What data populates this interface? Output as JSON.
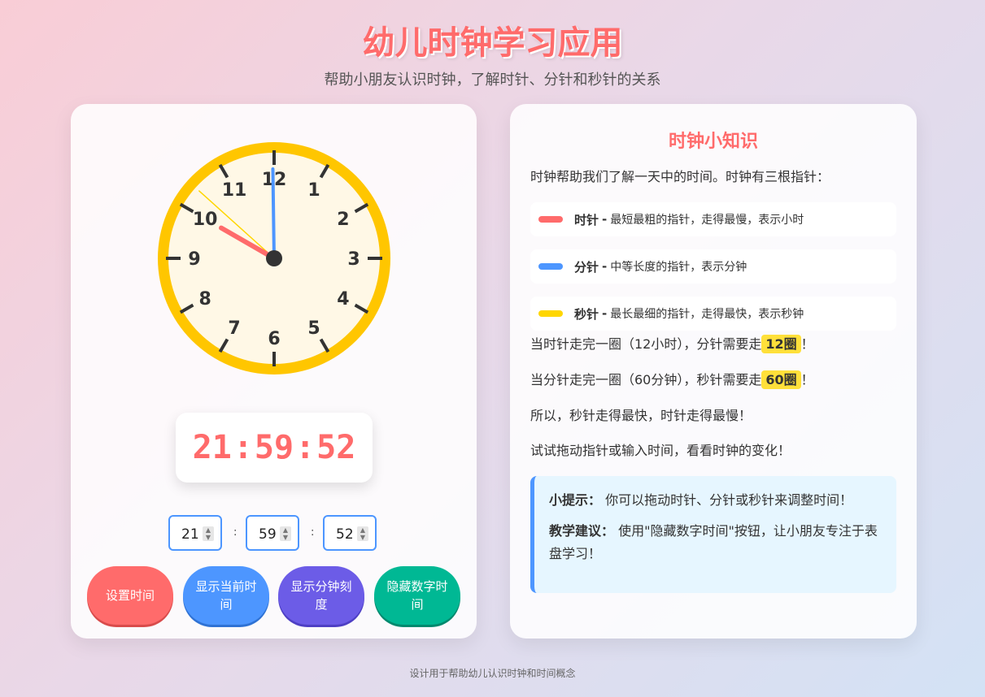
{
  "page": {
    "title": "幼儿时钟学习应用",
    "subtitle": "帮助小朋友认识时钟，了解时针、分针和秒针的关系",
    "footer": "设计用于帮助幼儿认识时钟和时间概念"
  },
  "clock": {
    "numbers": [
      "12",
      "1",
      "2",
      "3",
      "4",
      "5",
      "6",
      "7",
      "8",
      "9",
      "10",
      "11"
    ],
    "time": {
      "hours": 21,
      "minutes": 59,
      "seconds": 52
    },
    "digital": {
      "h": "21",
      "m": "59",
      "s": "52",
      "sep": ":"
    },
    "colors": {
      "rim": "#ffc600",
      "face": "#fff8e6",
      "hour_hand": "#ff6b6b",
      "minute_hand": "#4d96ff",
      "second_hand": "#ffd600"
    }
  },
  "inputs": {
    "hour": "21",
    "minute": "59",
    "second": "52",
    "sep": ":"
  },
  "buttons": {
    "set_time": "设置时间",
    "show_current": "显示当前时间",
    "show_minute_ticks": "显示分钟刻度",
    "hide_digital": "隐藏数字时间"
  },
  "info": {
    "title": "时钟小知识",
    "intro": "时钟帮助我们了解一天中的时间。时钟有三根指针：",
    "hands": [
      {
        "name": "时针",
        "sep": " - ",
        "desc": "最短最粗的指针，走得最慢，表示小时",
        "color": "#ff6b6b"
      },
      {
        "name": "分针",
        "sep": " - ",
        "desc": "中等长度的指针，表示分钟",
        "color": "#4d96ff"
      },
      {
        "name": "秒针",
        "sep": " - ",
        "desc": "最长最细的指针，走得最快，表示秒钟",
        "color": "#ffd600"
      }
    ],
    "fact1_pre": "当时针走完一圈（12小时），分针需要走",
    "fact1_hl": "12圈",
    "fact1_post": "！",
    "fact2_pre": "当分针走完一圈（60分钟），秒针需要走",
    "fact2_hl": "60圈",
    "fact2_post": "！",
    "fact3": "所以，秒针走得最快，时针走得最慢！",
    "fact4": "试试拖动指针或输入时间，看看时钟的变化！",
    "tip_label": "小提示：",
    "tip_text": "你可以拖动时针、分针或秒针来调整时间！",
    "advice_label": "教学建议：",
    "advice_text": "使用\"隐藏数字时间\"按钮，让小朋友专注于表盘学习！"
  }
}
